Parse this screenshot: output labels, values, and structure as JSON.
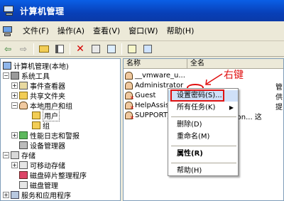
{
  "window": {
    "title": "计算机管理"
  },
  "menu": [
    "文件(F)",
    "操作(A)",
    "查看(V)",
    "窗口(W)",
    "帮助(H)"
  ],
  "toolbar": {
    "icons": [
      "back-arrow",
      "forward-arrow",
      "up-folder",
      "show-tree",
      "delete-x",
      "properties",
      "export",
      "help",
      "console"
    ]
  },
  "tree": {
    "root": "计算机管理(本地)",
    "items": [
      {
        "label": "系统工具",
        "indent": 1,
        "exp": "−",
        "icon": "tools"
      },
      {
        "label": "事件查看器",
        "indent": 2,
        "exp": "+",
        "icon": "event"
      },
      {
        "label": "共享文件夹",
        "indent": 2,
        "exp": "+",
        "icon": "share"
      },
      {
        "label": "本地用户和组",
        "indent": 2,
        "exp": "−",
        "icon": "users"
      },
      {
        "label": "用户",
        "indent": 3,
        "exp": "",
        "icon": "folder",
        "selected": true
      },
      {
        "label": "组",
        "indent": 3,
        "exp": "",
        "icon": "folder"
      },
      {
        "label": "性能日志和警报",
        "indent": 2,
        "exp": "+",
        "icon": "perf"
      },
      {
        "label": "设备管理器",
        "indent": 2,
        "exp": "",
        "icon": "dev"
      },
      {
        "label": "存储",
        "indent": 1,
        "exp": "−",
        "icon": "storage"
      },
      {
        "label": "可移动存储",
        "indent": 2,
        "exp": "+",
        "icon": "disk"
      },
      {
        "label": "磁盘碎片整理程序",
        "indent": 2,
        "exp": "",
        "icon": "defrag"
      },
      {
        "label": "磁盘管理",
        "indent": 2,
        "exp": "",
        "icon": "disk"
      },
      {
        "label": "服务和应用程序",
        "indent": 1,
        "exp": "+",
        "icon": "svc"
      }
    ]
  },
  "list": {
    "columns": [
      "名称",
      "全名"
    ],
    "rows": [
      {
        "name": "__vmware_u...",
        "desc": "",
        "disabled": false
      },
      {
        "name": "Administrator",
        "desc": "管",
        "disabled": false
      },
      {
        "name": "Guest",
        "desc": "供",
        "disabled": true
      },
      {
        "name": "HelpAssistant",
        "desc": "提",
        "disabled": true
      },
      {
        "name": "SUPPORT_...",
        "desc": "orporation...  这",
        "disabled": true
      }
    ]
  },
  "context_menu": {
    "items": [
      {
        "label": "设置密码(S)...",
        "highlight": true
      },
      {
        "label": "所有任务(K)",
        "submenu": true
      },
      {
        "sep": true
      },
      {
        "label": "删除(D)"
      },
      {
        "label": "重命名(M)"
      },
      {
        "sep": true
      },
      {
        "label": "属性(R)",
        "bold": true
      },
      {
        "sep": true
      },
      {
        "label": "帮助(H)"
      }
    ]
  },
  "annotation": {
    "text": "右键"
  },
  "colors": {
    "accent_red": "#e01010",
    "title_blue": "#0a5fe6"
  }
}
